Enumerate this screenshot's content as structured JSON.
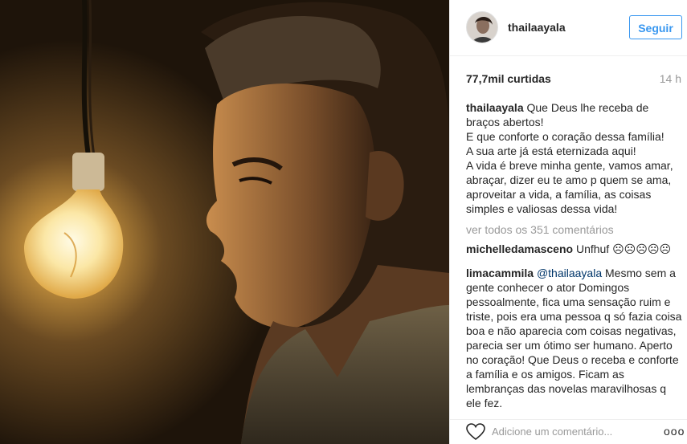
{
  "post": {
    "image_icon": "photo-of-man-beside-light-bulb"
  },
  "header": {
    "username": "thailaayala",
    "follow_label": "Seguir"
  },
  "stats": {
    "views": "77,7mil curtidas",
    "time_ago": "14 h"
  },
  "caption": {
    "user": "thailaayala",
    "text": "Que Deus lhe receba de braços abertos!\nE que conforte o coração dessa família!\nA sua arte já está eternizada aqui!\nA vida é breve minha gente, vamos amar, abraçar, dizer eu te amo p quem se ama, aproveitar a vida, a família, as coisas simples e valiosas dessa vida!"
  },
  "view_all_label": "ver todos os 351 comentários",
  "comments": [
    {
      "user": "michelledamasceno",
      "text": "Unfhuf ☹☹☹☹☹"
    },
    {
      "user": "limacammila",
      "mention": "@thailaayala",
      "text": "Mesmo sem a gente conhecer o ator Domingos pessoalmente, fica uma sensação ruim e triste, pois era uma pessoa q só fazia coisa boa e não aparecia com coisas negativas, parecia ser um ótimo ser humano. Aperto no coração! Que Deus o receba e conforte a família e os amigos. Ficam as lembranças das novelas maravilhosas q ele fez."
    }
  ],
  "footer": {
    "comment_placeholder": "Adicione um comentário...",
    "more_label": "ooo"
  },
  "colors": {
    "accent": "#3897f0",
    "muted": "#999999",
    "divider": "#efefef"
  }
}
